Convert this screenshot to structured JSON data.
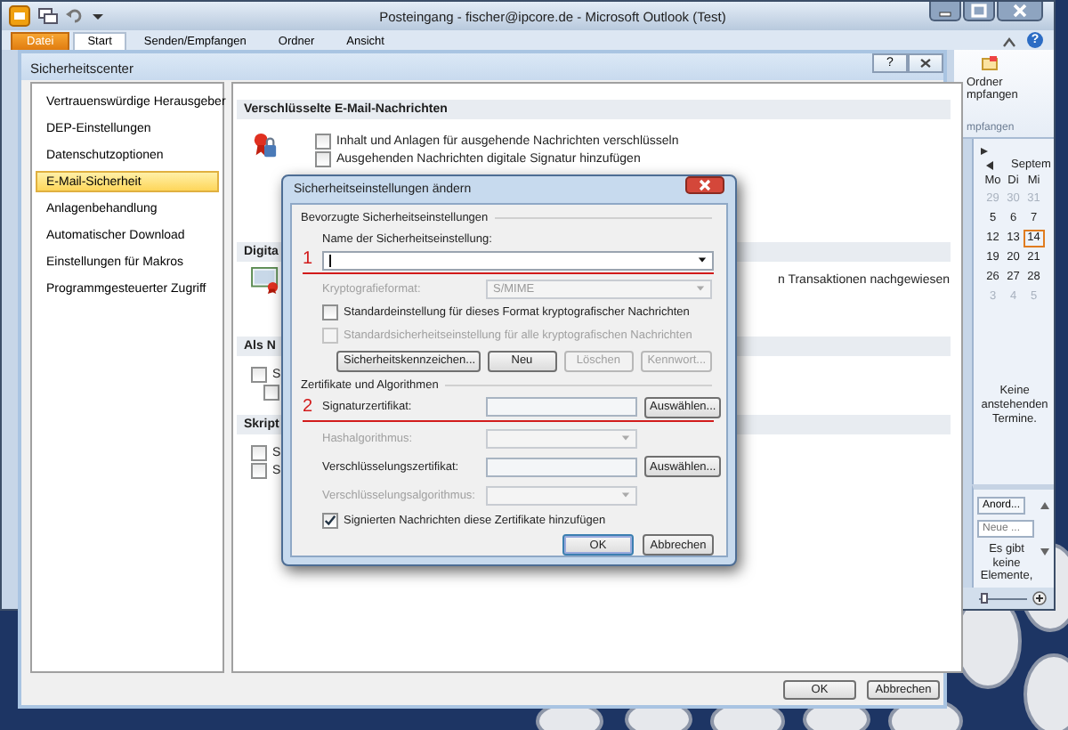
{
  "outlook": {
    "title": "Posteingang - fischer@ipcore.de  -  Microsoft Outlook (Test)",
    "tabs": [
      {
        "label": "Datei",
        "kind": "file",
        "selected": false
      },
      {
        "label": "Start",
        "kind": "tab",
        "selected": true
      },
      {
        "label": "Senden/Empfangen",
        "kind": "tab",
        "selected": false
      },
      {
        "label": "Ordner",
        "kind": "tab",
        "selected": false
      },
      {
        "label": "Ansicht",
        "kind": "tab",
        "selected": false
      }
    ],
    "help": "?",
    "ribbon": {
      "button_lines": [
        "Ordner",
        "mpfangen"
      ],
      "group": "mpfangen"
    },
    "calendar": {
      "month": "Septem",
      "weekdays": [
        "Mo",
        "Di",
        "Mi"
      ],
      "days": [
        {
          "label": "29",
          "dimmed": true,
          "selected": false
        },
        {
          "label": "30",
          "dimmed": true,
          "selected": false
        },
        {
          "label": "31",
          "dimmed": true,
          "selected": false
        },
        {
          "label": "5",
          "dimmed": false,
          "selected": false
        },
        {
          "label": "6",
          "dimmed": false,
          "selected": false
        },
        {
          "label": "7",
          "dimmed": false,
          "selected": false
        },
        {
          "label": "12",
          "dimmed": false,
          "selected": false
        },
        {
          "label": "13",
          "dimmed": false,
          "selected": false
        },
        {
          "label": "14",
          "dimmed": false,
          "selected": true
        },
        {
          "label": "19",
          "dimmed": false,
          "selected": false
        },
        {
          "label": "20",
          "dimmed": false,
          "selected": false
        },
        {
          "label": "21",
          "dimmed": false,
          "selected": false
        },
        {
          "label": "26",
          "dimmed": false,
          "selected": false
        },
        {
          "label": "27",
          "dimmed": false,
          "selected": false
        },
        {
          "label": "28",
          "dimmed": false,
          "selected": false
        },
        {
          "label": "3",
          "dimmed": true,
          "selected": false
        },
        {
          "label": "4",
          "dimmed": true,
          "selected": false
        },
        {
          "label": "5",
          "dimmed": true,
          "selected": false
        }
      ]
    },
    "appointments": "Keine anstehenden Termine.",
    "tasks": {
      "arrange": "Anord...",
      "new_placeholder": "Neue ...",
      "empty_text": "Es gibt keine Elemente,"
    },
    "zoom": {
      "level": 0.1
    }
  },
  "trust_center": {
    "title": "Sicherheitscenter",
    "help": "?",
    "nav": [
      {
        "label": "Vertrauenswürdige Herausgeber",
        "selected": false
      },
      {
        "label": "DEP-Einstellungen",
        "selected": false
      },
      {
        "label": "Datenschutzoptionen",
        "selected": false
      },
      {
        "label": "E-Mail-Sicherheit",
        "selected": true
      },
      {
        "label": "Anlagenbehandlung",
        "selected": false
      },
      {
        "label": "Automatischer Download",
        "selected": false
      },
      {
        "label": "Einstellungen für Makros",
        "selected": false
      },
      {
        "label": "Programmgesteuerter Zugriff",
        "selected": false
      }
    ],
    "sections": [
      {
        "kind": "encryption",
        "heading": "Verschlüsselte E-Mail-Nachrichten",
        "options": [
          {
            "label": "Inhalt und Anlagen für ausgehende Nachrichten verschlüsseln",
            "checked": false,
            "indented": false
          },
          {
            "label": "Ausgehenden Nachrichten digitale Signatur hinzufügen",
            "checked": false,
            "indented": false
          }
        ]
      },
      {
        "kind": "digital_id",
        "heading": "Digita",
        "note": "n Transaktionen nachgewiesen"
      },
      {
        "kind": "options",
        "heading": "Als N",
        "options": [
          {
            "label": "S",
            "checked": false,
            "indented": false
          },
          {
            "checked": false,
            "indented": true
          }
        ]
      },
      {
        "kind": "options",
        "heading": "Skript",
        "options": [
          {
            "label": "S",
            "checked": false,
            "indented": false
          },
          {
            "label": "S",
            "checked": false,
            "indented": false
          }
        ]
      }
    ],
    "buttons": [
      "OK",
      "Abbrechen"
    ]
  },
  "dialog": {
    "title": "Sicherheitseinstellungen ändern",
    "groups": [
      {
        "heading": "Bevorzugte Sicherheitseinstellungen",
        "rows": [
          {
            "kind": "caption",
            "label": "Name der Sicherheitseinstellung:"
          },
          {
            "kind": "combo",
            "marker": "1",
            "focused": true,
            "disabled": false
          },
          {
            "kind": "format",
            "label": "Kryptografieformat:",
            "value": "S/MIME",
            "disabled": true
          },
          {
            "kind": "checkbox",
            "label": "Standardeinstellung für dieses Format kryptografischer Nachrichten",
            "checked": false,
            "disabled": false
          },
          {
            "kind": "checkbox",
            "label": "Standardsicherheitseinstellung für alle kryptografischen Nachrichten",
            "checked": false,
            "disabled": true
          },
          {
            "kind": "buttons",
            "buttons": [
              {
                "label": "Sicherheitskennzeichen...",
                "disabled": false
              },
              {
                "label": "Neu",
                "disabled": false
              },
              {
                "label": "Löschen",
                "disabled": true
              },
              {
                "label": "Kennwort...",
                "disabled": true
              }
            ]
          }
        ]
      },
      {
        "heading": "Zertifikate und Algorithmen",
        "rows": [
          {
            "kind": "certificate",
            "label": "Signaturzertifikat:",
            "marker": "2",
            "button": "Auswählen...",
            "disabled": false
          },
          {
            "kind": "algorithm",
            "label": "Hashalgorithmus:",
            "disabled": true
          },
          {
            "kind": "certificate",
            "label": "Verschlüsselungszertifikat:",
            "button": "Auswählen...",
            "disabled": false
          },
          {
            "kind": "algorithm",
            "label": "Verschlüsselungsalgorithmus:",
            "disabled": true
          },
          {
            "kind": "checkbox",
            "label": "Signierten Nachrichten diese Zertifikate hinzufügen",
            "checked": true,
            "disabled": false
          }
        ]
      }
    ],
    "buttons": [
      {
        "label": "OK",
        "default": true
      },
      {
        "label": "Abbrechen",
        "default": false
      }
    ]
  }
}
